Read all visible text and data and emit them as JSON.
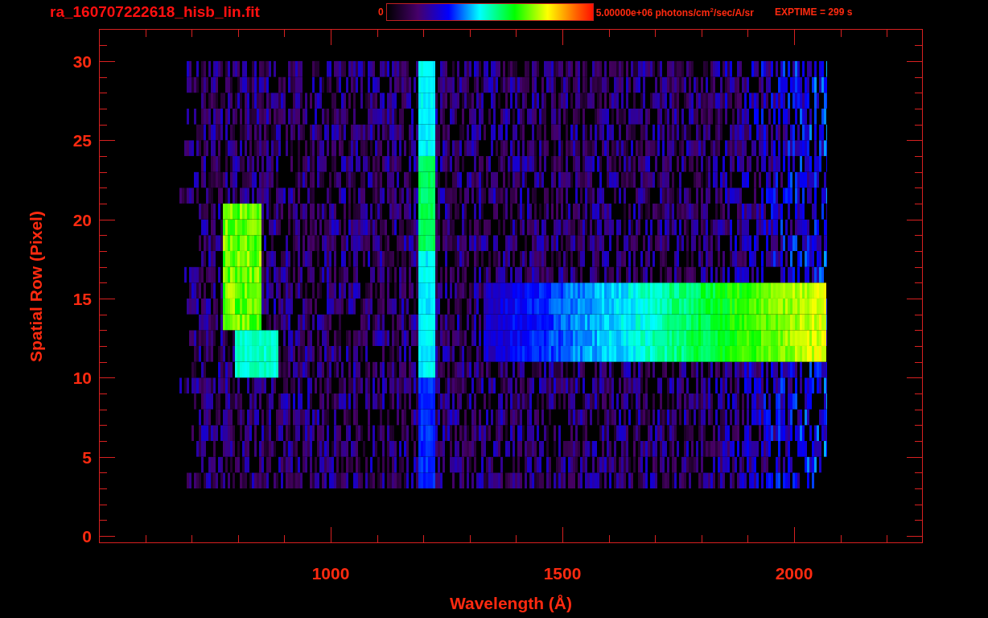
{
  "title": "ra_160707222618_hisb_lin.fit",
  "colorbar": {
    "min_label": "0",
    "max_label": "5.00000e+06 photons/cm$^{2}$/sec/A/sr"
  },
  "exposure": "EXPTIME = 299 s",
  "plot": {
    "xlabel": "Wavelength (Å)",
    "ylabel": "Spatial Row (Pixel)",
    "xticks": [
      "1000",
      "1500",
      "2000"
    ],
    "yticks": [
      "30",
      "25",
      "20",
      "15",
      "10",
      "5",
      "0"
    ]
  }
}
